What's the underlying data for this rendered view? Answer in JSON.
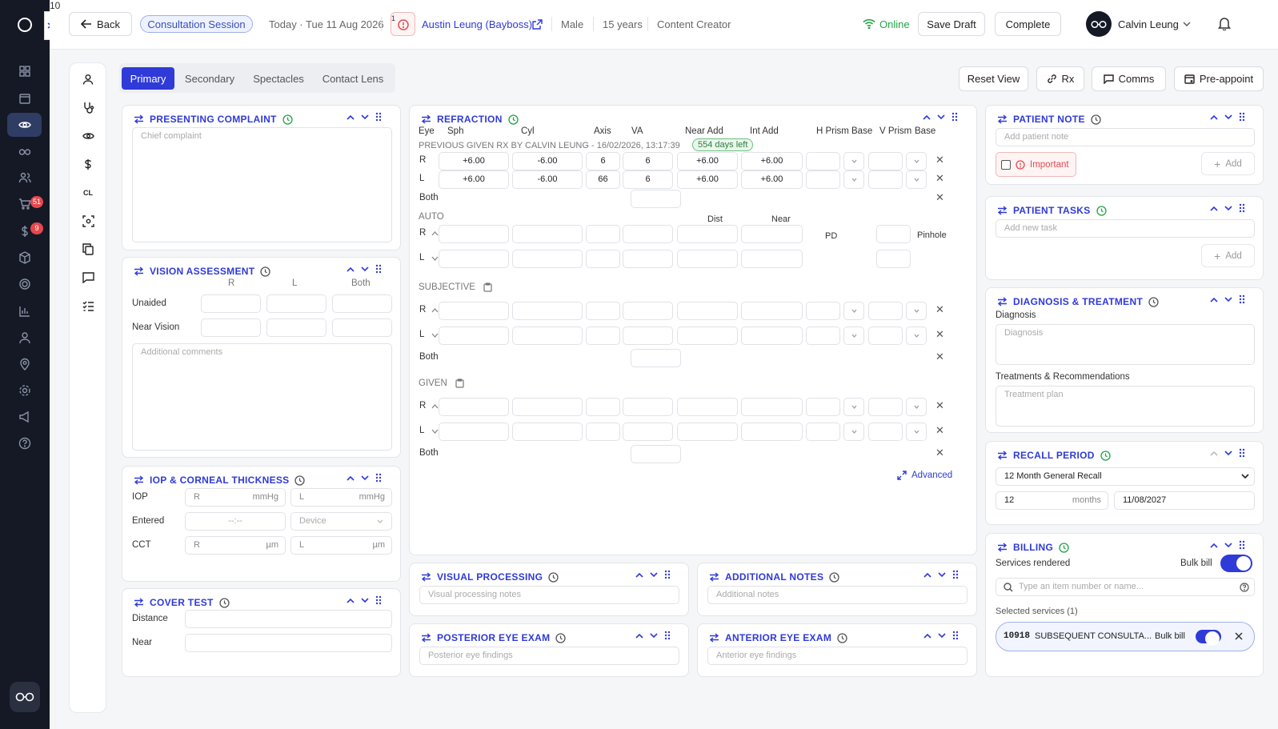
{
  "rail": {
    "logo": "o",
    "badge_orders": "51",
    "badge_billing": "9"
  },
  "topbar": {
    "back": "Back",
    "session": "Consultation Session",
    "date": "Today · Tue 11 Aug 2026",
    "alert_count": "1",
    "patient": "Austin Leung (Bayboss)",
    "sex": "Male",
    "age": "15 years",
    "occupation": "Content Creator",
    "status": "Online",
    "save": "Save Draft",
    "complete": "Complete",
    "user": "Calvin Leung",
    "notif": "10"
  },
  "tabs": [
    "Primary",
    "Secondary",
    "Spectacles",
    "Contact Lens"
  ],
  "toolbar": {
    "reset": "Reset View",
    "rx": "Rx",
    "comms": "Comms",
    "preappoint": "Pre-appoint"
  },
  "presenting": {
    "title": "PRESENTING COMPLAINT",
    "placeholder": "Chief complaint"
  },
  "vision": {
    "title": "VISION ASSESSMENT",
    "cols": [
      "R",
      "L",
      "Both"
    ],
    "rows": [
      "Unaided",
      "Near Vision"
    ],
    "comments": "Additional comments"
  },
  "iop": {
    "title": "IOP & CORNEAL THICKNESS",
    "iop": "IOP",
    "entered": "Entered",
    "cct": "CCT",
    "r": "R",
    "l": "L",
    "mmhg": "mmHg",
    "um": "µm",
    "time": "--:--",
    "device": "Device"
  },
  "cover": {
    "title": "COVER TEST",
    "distance": "Distance",
    "near": "Near"
  },
  "refraction": {
    "title": "REFRACTION",
    "headers": [
      "Eye",
      "Sph",
      "Cyl",
      "Axis",
      "VA",
      "Near Add",
      "Int Add",
      "H Prism",
      "Base",
      "V Prism",
      "Base"
    ],
    "prev_label": "PREVIOUS GIVEN RX BY CALVIN LEUNG - 16/02/2026, 13:17:39",
    "days_left": "554 days left",
    "r": "R",
    "l": "L",
    "both": "Both",
    "prev_r": [
      "+6.00",
      "-6.00",
      "6",
      "6",
      "+6.00",
      "+6.00"
    ],
    "prev_l": [
      "+6.00",
      "-6.00",
      "66",
      "6",
      "+6.00",
      "+6.00"
    ],
    "auto": "AUTO",
    "dist": "Dist",
    "near": "Near",
    "pd": "PD",
    "pinhole": "Pinhole",
    "subjective": "SUBJECTIVE",
    "given": "GIVEN",
    "advanced": "Advanced"
  },
  "visual": {
    "title": "VISUAL PROCESSING",
    "placeholder": "Visual processing notes"
  },
  "addnotes": {
    "title": "ADDITIONAL NOTES",
    "placeholder": "Additional notes"
  },
  "posterior": {
    "title": "POSTERIOR EYE EXAM",
    "placeholder": "Posterior eye findings"
  },
  "anterior": {
    "title": "ANTERIOR EYE EXAM",
    "placeholder": "Anterior eye findings"
  },
  "pnote": {
    "title": "PATIENT NOTE",
    "placeholder": "Add patient note",
    "important": "Important",
    "add": "Add"
  },
  "ptasks": {
    "title": "PATIENT TASKS",
    "placeholder": "Add new task",
    "add": "Add"
  },
  "diag": {
    "title": "DIAGNOSIS & TREATMENT",
    "diagnosis": "Diagnosis",
    "diag_ph": "Diagnosis",
    "treat": "Treatments & Recommendations",
    "treat_ph": "Treatment plan"
  },
  "recall": {
    "title": "RECALL PERIOD",
    "option": "12 Month General Recall",
    "num": "12",
    "unit": "months",
    "date": "11/08/2027"
  },
  "billing": {
    "title": "BILLING",
    "services": "Services rendered",
    "bulkbill": "Bulk bill",
    "search": "Type an item number or name...",
    "selected": "Selected services (1)",
    "item_code": "10918",
    "item_name": "SUBSEQUENT CONSULTA...",
    "item_bulk": "Bulk bill"
  },
  "colors": {
    "accent": "#2f3ad9",
    "online": "#22a447",
    "danger": "#e5484d"
  }
}
